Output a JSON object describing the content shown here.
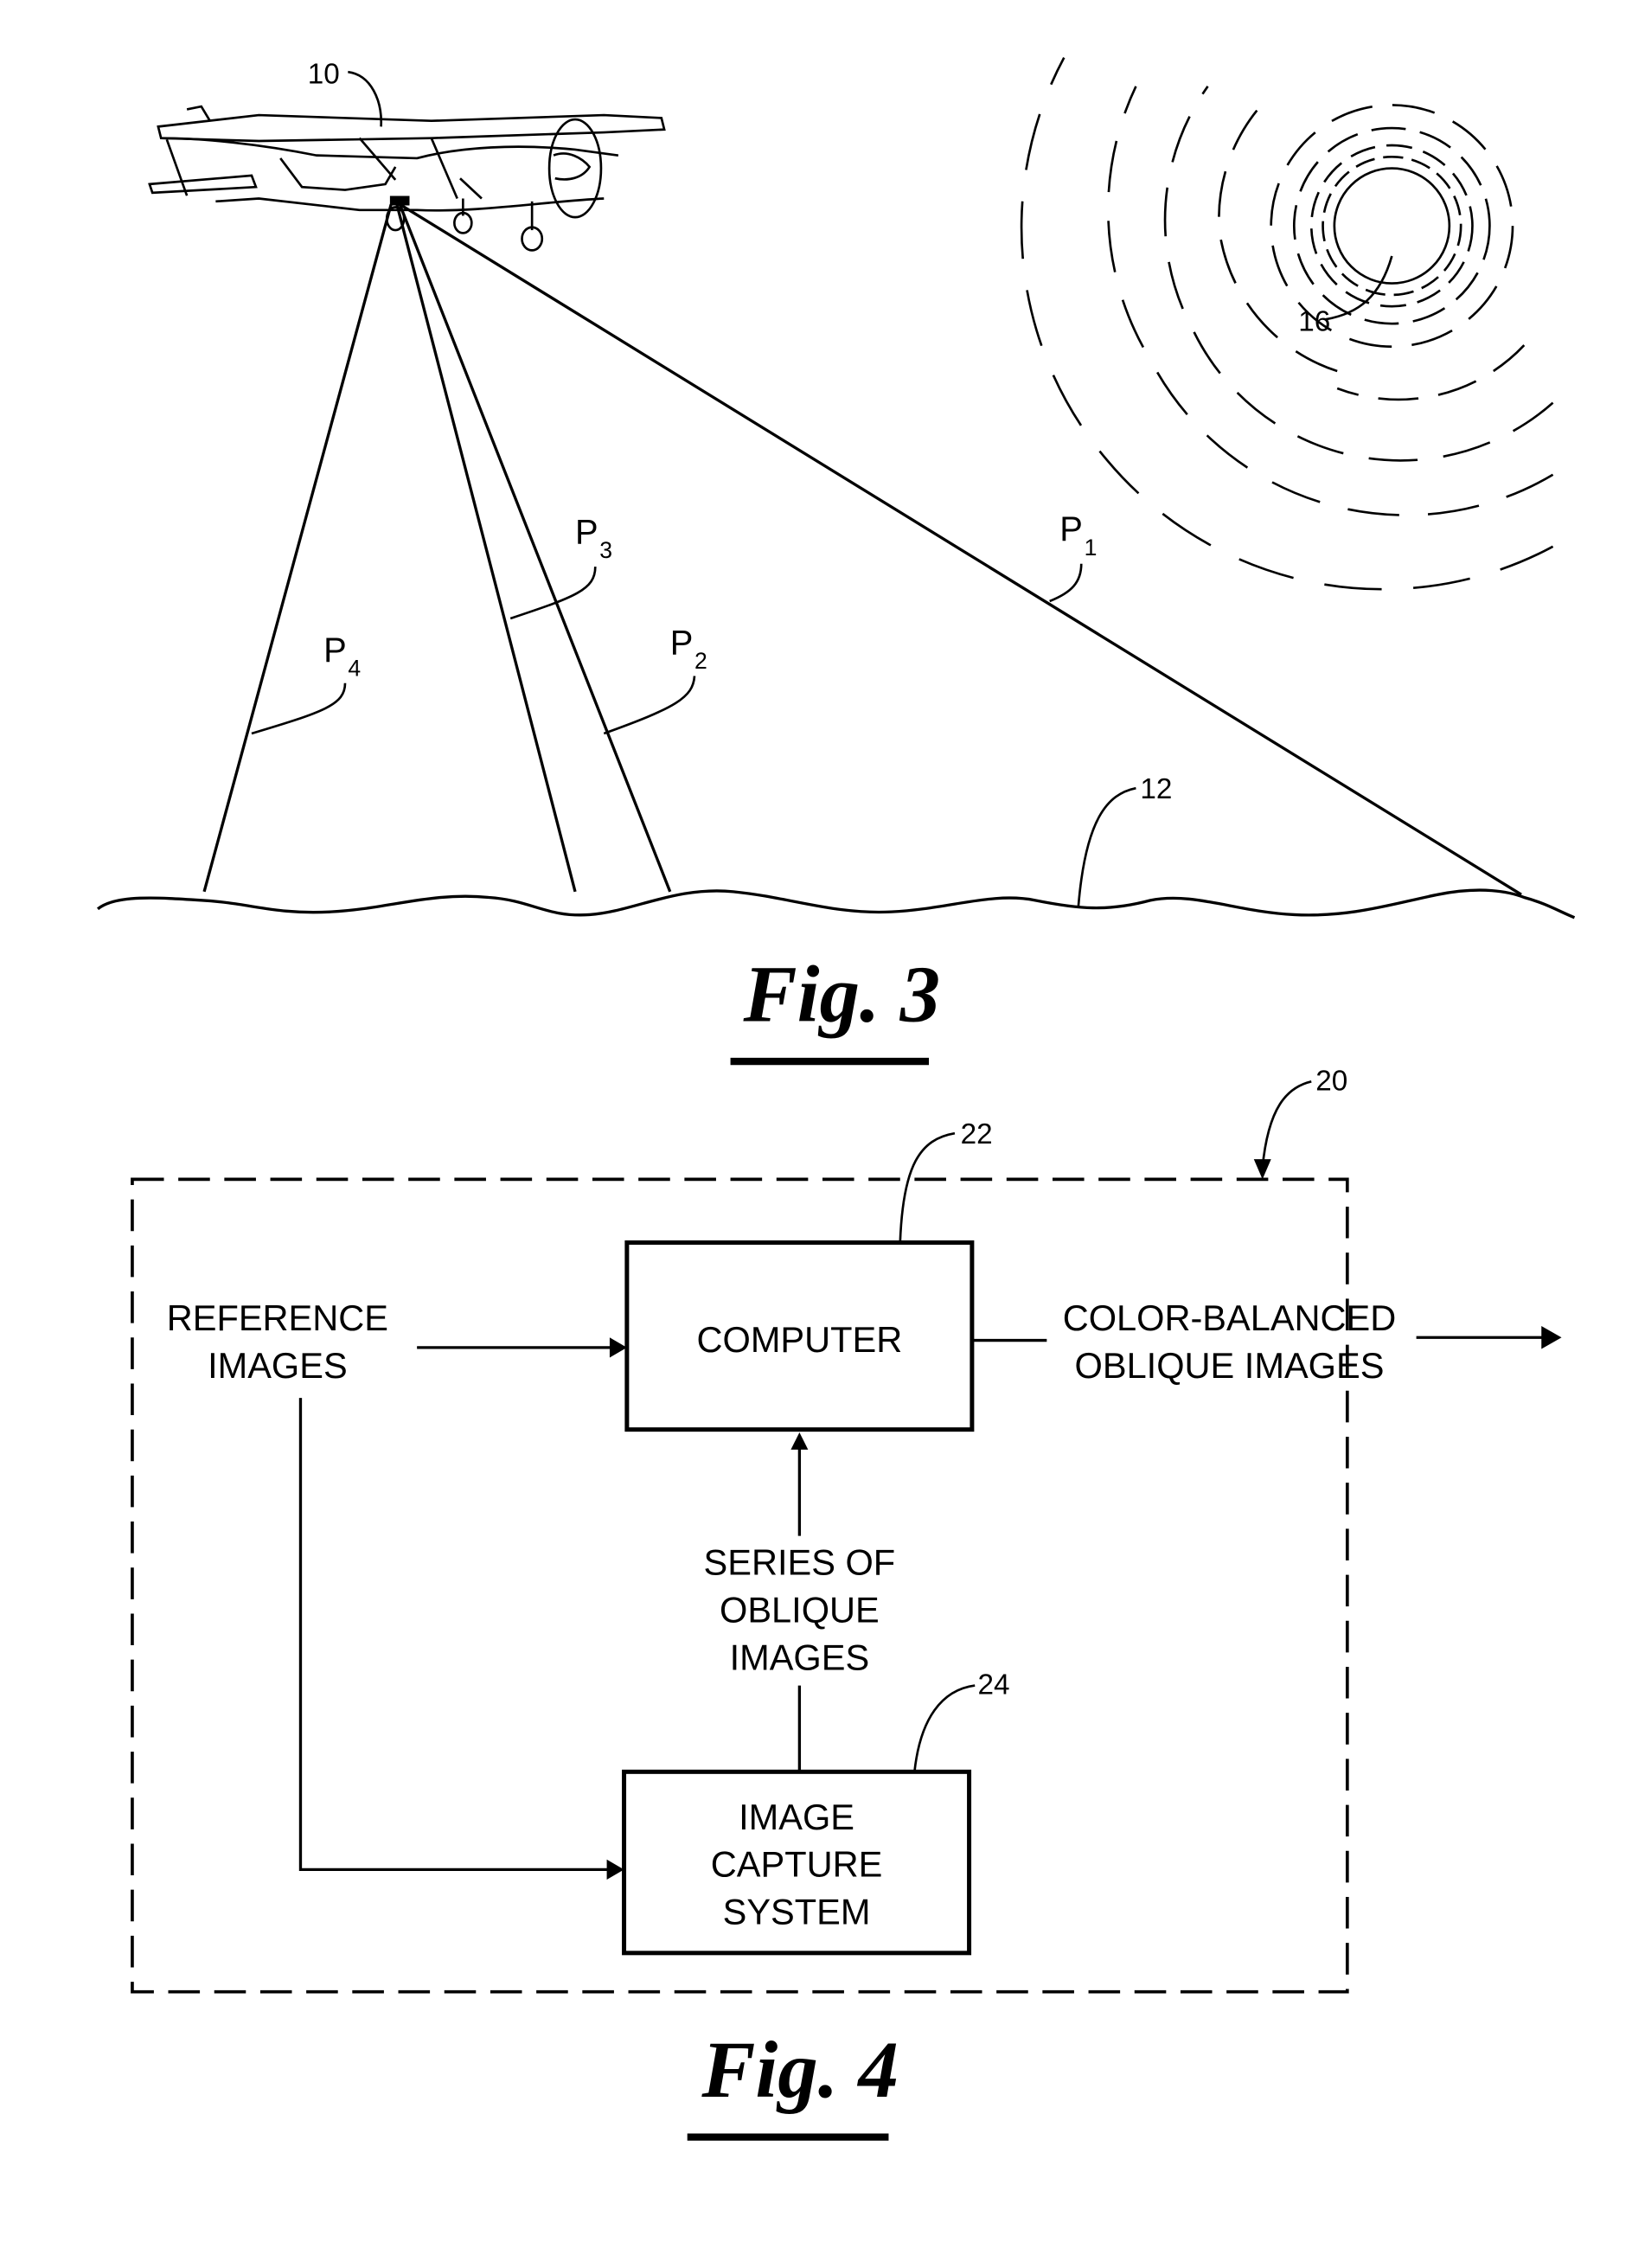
{
  "figures": {
    "fig3": {
      "caption": "Fig. 3",
      "refs": {
        "aircraft": "10",
        "ground": "12",
        "sun": "16"
      },
      "paths": [
        {
          "label": "P",
          "sub": "1"
        },
        {
          "label": "P",
          "sub": "2"
        },
        {
          "label": "P",
          "sub": "3"
        },
        {
          "label": "P",
          "sub": "4"
        }
      ]
    },
    "fig4": {
      "caption": "Fig. 4",
      "refs": {
        "system": "20",
        "computer": "22",
        "capture": "24"
      },
      "inputs": {
        "reference_line1": "REFERENCE",
        "reference_line2": "IMAGES"
      },
      "computer": {
        "label": "COMPUTER"
      },
      "output": {
        "line1": "COLOR-BALANCED",
        "line2": "OBLIQUE IMAGES"
      },
      "series": {
        "line1": "SERIES OF",
        "line2": "OBLIQUE",
        "line3": "IMAGES"
      },
      "capture": {
        "line1": "IMAGE",
        "line2": "CAPTURE",
        "line3": "SYSTEM"
      }
    }
  }
}
